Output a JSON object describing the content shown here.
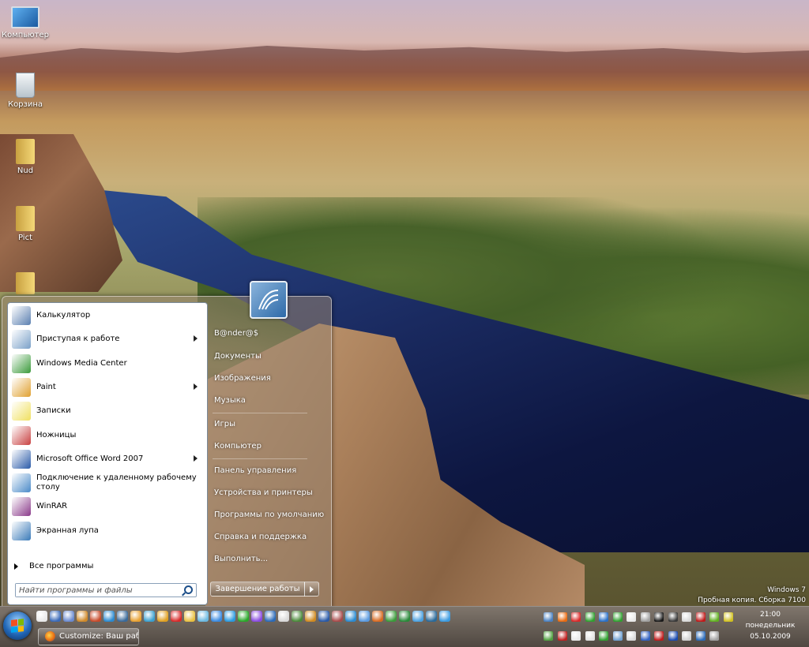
{
  "desktop": {
    "icons": [
      {
        "label": "Компьютер",
        "icon": "computer-icon"
      },
      {
        "label": "Корзина",
        "icon": "recycle-bin-icon"
      },
      {
        "label": "Nud",
        "icon": "folder-icon"
      },
      {
        "label": "Pict",
        "icon": "folder-icon"
      },
      {
        "label": "",
        "icon": "folder-icon"
      }
    ],
    "watermark": {
      "line1": "Windows 7",
      "line2": "Пробная копия. Сборка 7100"
    }
  },
  "start_menu": {
    "programs": [
      {
        "label": "Калькулятор",
        "icon": "calculator-icon",
        "submenu": false,
        "color": "#5a7fb0"
      },
      {
        "label": "Приступая к работе",
        "icon": "getting-started-icon",
        "submenu": true,
        "color": "#7aa0c8"
      },
      {
        "label": "Windows Media Center",
        "icon": "media-center-icon",
        "submenu": false,
        "color": "#3a9a3a"
      },
      {
        "label": "Paint",
        "icon": "paint-icon",
        "submenu": true,
        "color": "#e0a030"
      },
      {
        "label": "Записки",
        "icon": "sticky-notes-icon",
        "submenu": false,
        "color": "#f0e060"
      },
      {
        "label": "Ножницы",
        "icon": "snipping-tool-icon",
        "submenu": false,
        "color": "#c84040"
      },
      {
        "label": "Microsoft Office Word 2007",
        "icon": "word-icon",
        "submenu": true,
        "color": "#2a5aa8"
      },
      {
        "label": "Подключение к удаленному рабочему столу",
        "icon": "remote-desktop-icon",
        "submenu": false,
        "color": "#4a8ac8"
      },
      {
        "label": "WinRAR",
        "icon": "winrar-icon",
        "submenu": false,
        "color": "#8a3a8a"
      },
      {
        "label": "Экранная лупа",
        "icon": "magnifier-icon",
        "submenu": false,
        "color": "#3a7ab8"
      }
    ],
    "all_programs": "Все программы",
    "search_placeholder": "Найти программы и файлы",
    "right_items": [
      "B@nder@$",
      "Документы",
      "Изображения",
      "Музыка",
      "Игры",
      "Компьютер",
      "Панель управления",
      "Устройства и принтеры",
      "Программы по умолчанию",
      "Справка и поддержка",
      "Выполнить..."
    ],
    "shutdown_label": "Завершение работы"
  },
  "taskbar": {
    "task_button": "Customize: Ваш раб...",
    "clock": {
      "time": "21:00",
      "day": "понедельник",
      "date": "05.10.2009"
    }
  }
}
